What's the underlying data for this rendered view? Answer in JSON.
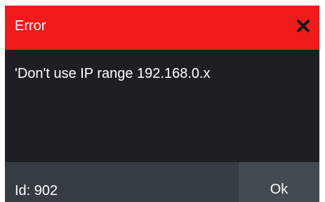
{
  "dialog": {
    "title": "Error",
    "message": "'Don't use IP range 192.168.0.x",
    "id_label": "Id: 902",
    "ok_label": "Ok",
    "close_icon": "close-icon"
  },
  "colors": {
    "title_bar": "#f11a1a",
    "body": "#1c2022",
    "footer": "#353c43",
    "ok_button": "#424a52",
    "text": "#ffffff"
  }
}
